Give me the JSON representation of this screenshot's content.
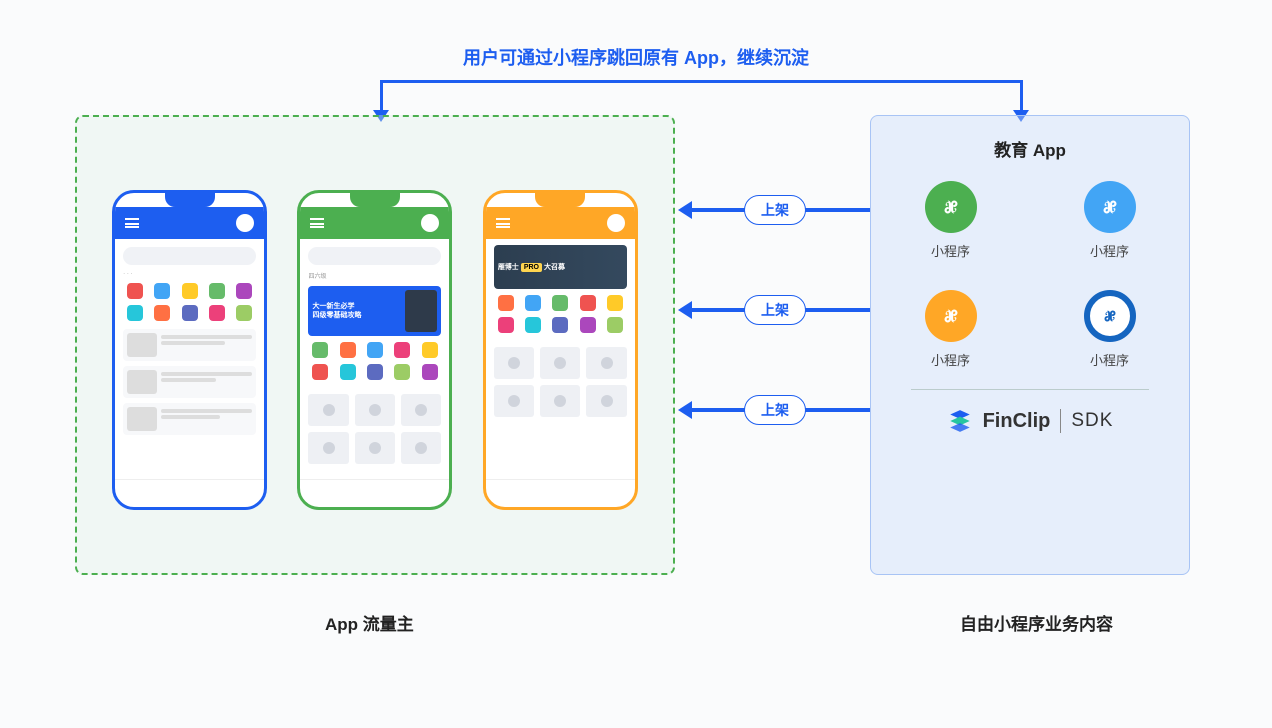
{
  "top_flow_text": "用户可通过小程序跳回原有 App，继续沉淀",
  "left_panel_label": "App 流量主",
  "right_panel": {
    "title": "教育 App",
    "label": "自由小程序业务内容",
    "minis": [
      {
        "label": "小程序",
        "color": "green"
      },
      {
        "label": "小程序",
        "color": "lblue"
      },
      {
        "label": "小程序",
        "color": "orange"
      },
      {
        "label": "小程序",
        "color": "ring"
      }
    ],
    "sdk_brand": "FinClip",
    "sdk_text": "SDK"
  },
  "arrows": [
    {
      "label": "上架"
    },
    {
      "label": "上架"
    },
    {
      "label": "上架"
    }
  ],
  "phones": {
    "green": {
      "tab": "四六级",
      "banner_line1": "大一新生必学",
      "banner_line2": "四级零基础攻略"
    },
    "orange": {
      "banner_text1": "雁博士",
      "banner_text2": "PRO",
      "banner_text3": "大召募"
    }
  },
  "colors": {
    "primary": "#1d5ef0",
    "green": "#4caf50",
    "orange": "#ffa726",
    "lblue": "#42a5f5"
  }
}
